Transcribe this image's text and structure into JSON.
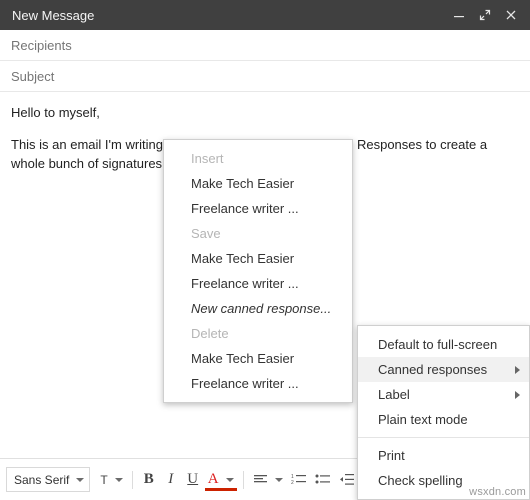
{
  "window": {
    "title": "New Message",
    "buttons": [
      {
        "name": "minimize-button",
        "glyph": "—"
      },
      {
        "name": "fullscreen-button",
        "glyph": "⤢"
      },
      {
        "name": "close-button",
        "glyph": "✕"
      }
    ]
  },
  "fields": {
    "recipients_placeholder": "Recipients",
    "subject_placeholder": "Subject"
  },
  "body": {
    "line1": "Hello to myself,",
    "line2": "This is an email I'm writing to myself to test Gmail's Canned Responses to create a whole bunch of signatures for ..."
  },
  "canned_menu": {
    "insert_label": "Insert",
    "insert_items": [
      "Make Tech Easier",
      "Freelance writer ..."
    ],
    "save_label": "Save",
    "save_items": [
      "Make Tech Easier",
      "Freelance writer ..."
    ],
    "new_response_label": "New canned response...",
    "delete_label": "Delete",
    "delete_items": [
      "Make Tech Easier",
      "Freelance writer ..."
    ]
  },
  "more_menu": {
    "items": [
      {
        "label": "Default to full-screen",
        "submenu": false,
        "highlight": false
      },
      {
        "label": "Canned responses",
        "submenu": true,
        "highlight": true
      },
      {
        "label": "Label",
        "submenu": true,
        "highlight": false
      },
      {
        "label": "Plain text mode",
        "submenu": false,
        "highlight": false
      },
      {
        "label": "Print",
        "submenu": false,
        "highlight": false
      },
      {
        "label": "Check spelling",
        "submenu": false,
        "highlight": false
      }
    ]
  },
  "toolbar": {
    "font_name": "Sans Serif",
    "size_label": "T",
    "bold_label": "B",
    "italic_label": "I",
    "underline_label": "U",
    "textcolor_label": "A"
  },
  "watermark": "wsxdn.com",
  "colors": {
    "titlebar": "#404040",
    "placeholder": "#757575",
    "menu_highlight": "#f1f1f1",
    "disabled_text": "#b5b5b5"
  }
}
